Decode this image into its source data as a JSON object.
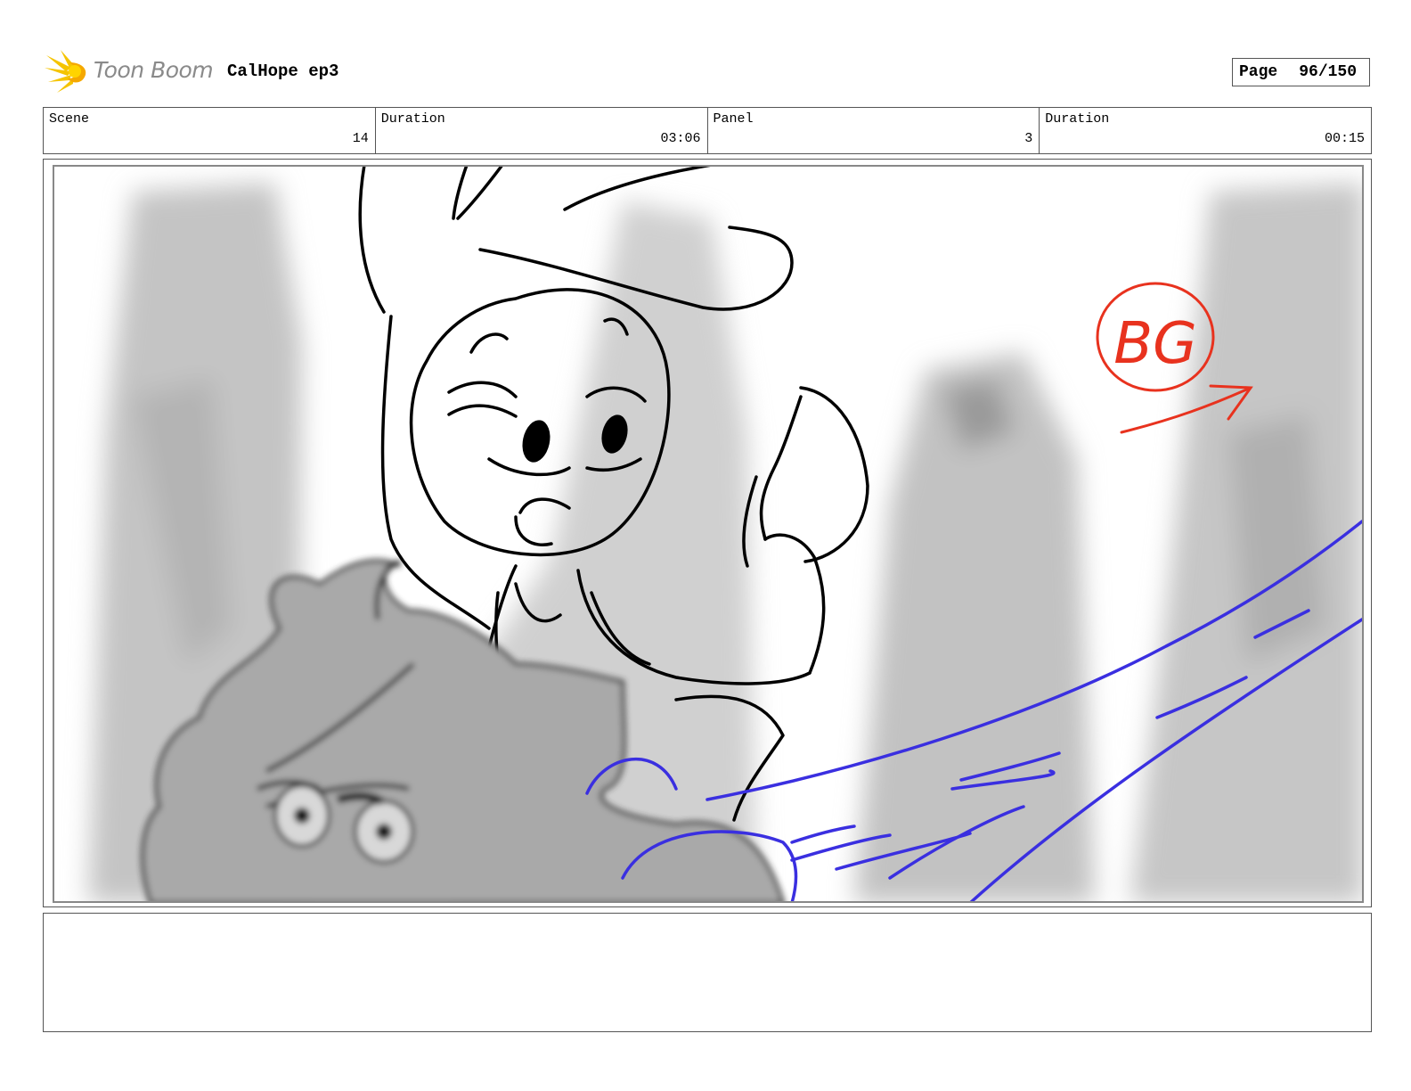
{
  "header": {
    "brand": "Toon Boom",
    "project_title": "CalHope ep3",
    "page_label": "Page",
    "page_value": "96/150"
  },
  "info_bar": [
    {
      "label": "Scene",
      "value": "14"
    },
    {
      "label": "Duration",
      "value": "03:06"
    },
    {
      "label": "Panel",
      "value": "3"
    },
    {
      "label": "Duration",
      "value": "00:15"
    }
  ],
  "panel": {
    "annotation_text": "BG",
    "annotation_color": "#e8321e",
    "fx_color": "#3a2fe0"
  },
  "notes": {
    "text": ""
  }
}
